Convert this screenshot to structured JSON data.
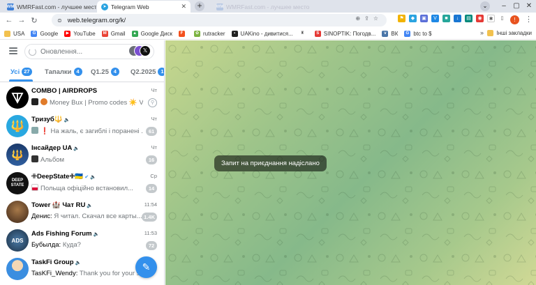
{
  "browser": {
    "tabs": [
      {
        "title": "WMRFast.com - лучшее место д",
        "favicon": "WM",
        "active": false
      },
      {
        "title": "Telegram Web",
        "favicon": "telegram-icon",
        "active": true
      },
      {
        "title": "WMRFast.com - лучшее место д",
        "favicon": "WM",
        "active": false
      }
    ],
    "url": "web.telegram.org/k/",
    "profile_initial": "!",
    "bookmarks": [
      {
        "label": "USA",
        "icon": "folder-icon",
        "color": "#f2c14e"
      },
      {
        "label": "Google",
        "icon": "google-icon",
        "color": "#4285f4"
      },
      {
        "label": "YouTube",
        "icon": "youtube-icon",
        "color": "#ff0000"
      },
      {
        "label": "Gmail",
        "icon": "gmail-icon",
        "color": "#ea4335"
      },
      {
        "label": "Google Диск",
        "icon": "drive-icon",
        "color": "#34a853"
      },
      {
        "label": "",
        "icon": "f-icon",
        "color": "#f4511e"
      },
      {
        "label": "rutracker",
        "icon": "rutracker-icon",
        "color": "#7cb342"
      },
      {
        "label": "UAKino - дивитися...",
        "icon": "uakino-icon",
        "color": "#222222"
      },
      {
        "label": "",
        "icon": "chess-icon",
        "color": "#555555"
      },
      {
        "label": "SINOPTIK: Погодв...",
        "icon": "sinoptik-icon",
        "color": "#e53935"
      },
      {
        "label": "ВК",
        "icon": "vk-icon",
        "color": "#4a76a8"
      },
      {
        "label": "btc to $",
        "icon": "google-icon",
        "color": "#4285f4"
      }
    ],
    "bookmarks_more": "»",
    "other_bookmarks": "Інші закладки"
  },
  "telegram": {
    "search_placeholder": "Оновлення...",
    "folders": [
      {
        "label": "Усі",
        "count": "27",
        "active": true
      },
      {
        "label": "Тапалки",
        "count": "4",
        "active": false
      },
      {
        "label": "Q1.25",
        "count": "4",
        "active": false
      },
      {
        "label": "Q2.2025",
        "count": "1",
        "active": false
      }
    ],
    "chats": [
      {
        "name": "COMBO | AIRDROPS",
        "time": "Чт",
        "preview": "Money Bux | Promo codes ☀️ V...",
        "badge": "",
        "pinned": true,
        "avatar_text": "",
        "avatar_color": "#000000"
      },
      {
        "name": "Тризуб🔱",
        "time": "Чт",
        "preview": "❗ На жаль, є загиблі і поранені ...",
        "badge": "61",
        "pinned": false,
        "avatar_text": "",
        "avatar_color": "#29a8e0"
      },
      {
        "name": "Інсайдер UA",
        "time": "Чт",
        "preview": "Альбом",
        "badge": "16",
        "pinned": false,
        "avatar_text": "",
        "avatar_color": "#1b3a6b"
      },
      {
        "name": "✙DeepState✙🇺🇦",
        "time": "Ср",
        "preview": "Польща офіційно встановил...",
        "badge": "14",
        "pinned": false,
        "avatar_text": "DEEP STATE",
        "avatar_color": "#111111"
      },
      {
        "name": "Tower 🏰 Чат RU",
        "time": "11:54",
        "sender": "Денис:",
        "preview": "Я читал. Скачал все карты...",
        "badge": "1.4K",
        "pinned": false,
        "avatar_text": "",
        "avatar_color": "#5a3b2a"
      },
      {
        "name": "Ads Fishing Forum",
        "time": "11:53",
        "sender": "Бубылда:",
        "preview": "Куда?",
        "badge": "72",
        "pinned": false,
        "avatar_text": "ADS",
        "avatar_color": "#2a4a6a"
      },
      {
        "name": "TaskFi Group",
        "time": "",
        "sender": "TasKFi_Wendy:",
        "preview": "Thank you for your s...",
        "badge": "",
        "pinned": false,
        "avatar_text": "",
        "avatar_color": "#3b8ee0"
      }
    ],
    "toast": "Запит на приєднання надіслано",
    "compose_icon": "pencil-icon",
    "accent": "#3390ec"
  }
}
